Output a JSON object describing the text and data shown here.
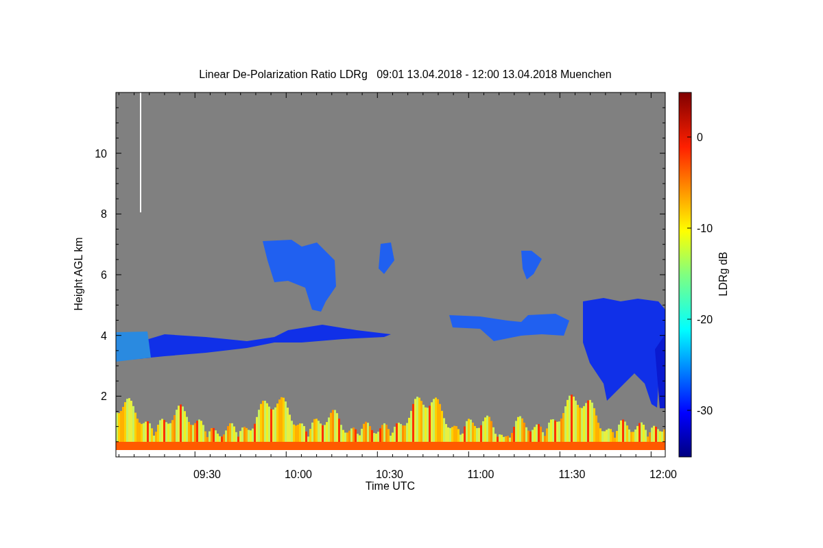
{
  "title": "Linear De-Polarization Ratio LDRg   09:01 13.04.2018 - 12:00 13.04.2018 Muenchen",
  "y_axis": {
    "label": "Height AGL km",
    "ticks": [
      "10",
      "8",
      "6",
      "4",
      "2"
    ]
  },
  "x_axis": {
    "label": "Time UTC",
    "ticks": [
      "09:30",
      "10:00",
      "10:30",
      "11:00",
      "11:30",
      "12:00"
    ]
  },
  "colorbar": {
    "label": "LDRg dB",
    "ticks": [
      "0",
      "-10",
      "-20",
      "-30"
    ]
  }
}
